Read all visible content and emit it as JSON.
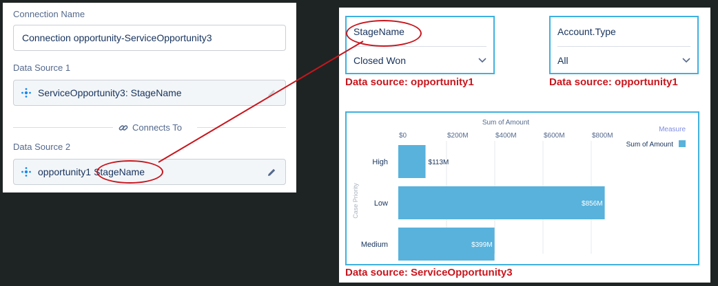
{
  "connection": {
    "name_label": "Connection Name",
    "name_value": "Connection opportunity-ServiceOpportunity3",
    "source1_label": "Data Source 1",
    "source1_value": "ServiceOpportunity3: StageName",
    "connects_label": "Connects To",
    "source2_label": "Data Source 2",
    "source2_dataset": "opportunity1",
    "source2_field": "StageName"
  },
  "filters": [
    {
      "title": "StageName",
      "value": "Closed Won",
      "source_note": "Data source: opportunity1"
    },
    {
      "title": "Account.Type",
      "value": "All",
      "source_note": "Data source: opportunity1"
    }
  ],
  "chart_note": "Data source: ServiceOpportunity3",
  "colors": {
    "accent_red": "#c8161d",
    "frame_blue": "#3db1e0",
    "bar_blue": "#58b2dc"
  },
  "chart_data": {
    "type": "bar",
    "orientation": "horizontal",
    "title": "Sum of Amount",
    "ylabel": "Case Priority",
    "categories": [
      "High",
      "Low",
      "Medium"
    ],
    "series": [
      {
        "name": "Sum of Amount",
        "values": [
          113,
          856,
          399
        ]
      }
    ],
    "value_labels": [
      "$113M",
      "$856M",
      "$399M"
    ],
    "xticks": [
      "$0",
      "$200M",
      "$400M",
      "$600M",
      "$800M"
    ],
    "xlim": [
      0,
      900
    ],
    "legend_title": "Measure",
    "legend_position": "top-right",
    "grid": true
  }
}
